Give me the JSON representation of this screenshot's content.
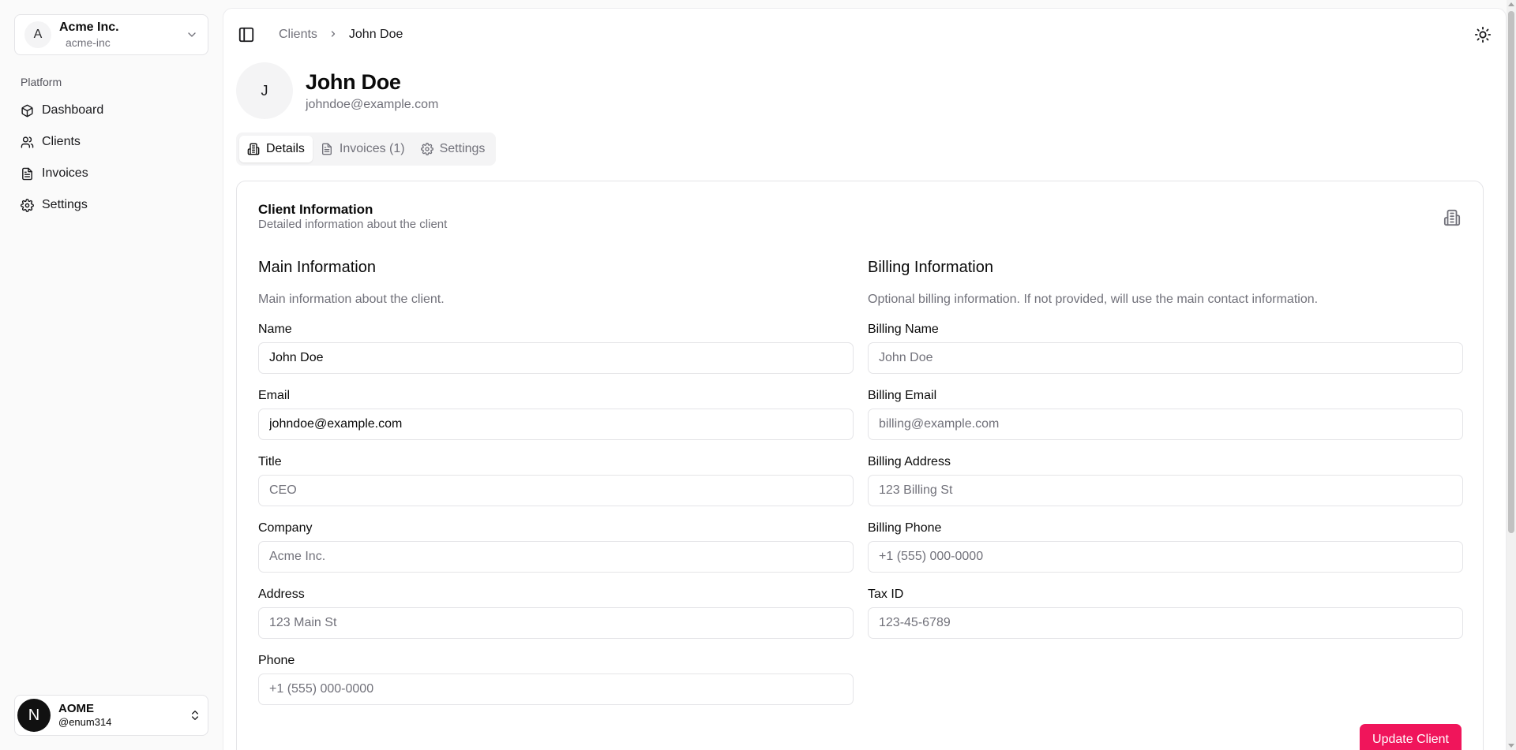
{
  "team": {
    "initial": "A",
    "name": "Acme Inc.",
    "slug": "acme-inc"
  },
  "sidebar": {
    "group_label": "Platform",
    "items": [
      {
        "label": "Dashboard",
        "icon": "box-icon"
      },
      {
        "label": "Clients",
        "icon": "users-icon"
      },
      {
        "label": "Invoices",
        "icon": "file-text-icon"
      },
      {
        "label": "Settings",
        "icon": "gear-icon"
      }
    ]
  },
  "user": {
    "initial": "N",
    "name": "AOME",
    "handle": "@enum314"
  },
  "breadcrumb": {
    "parent": "Clients",
    "current": "John Doe"
  },
  "profile": {
    "initial": "J",
    "name": "John Doe",
    "email": "johndoe@example.com"
  },
  "tabs": [
    {
      "label": "Details",
      "active": true
    },
    {
      "label": "Invoices (1)",
      "active": false
    },
    {
      "label": "Settings",
      "active": false
    }
  ],
  "card": {
    "title": "Client Information",
    "description": "Detailed information about the client"
  },
  "main_info": {
    "title": "Main Information",
    "description": "Main information about the client.",
    "fields": [
      {
        "label": "Name",
        "value": "John Doe",
        "placeholder": ""
      },
      {
        "label": "Email",
        "value": "johndoe@example.com",
        "placeholder": ""
      },
      {
        "label": "Title",
        "value": "",
        "placeholder": "CEO"
      },
      {
        "label": "Company",
        "value": "",
        "placeholder": "Acme Inc."
      },
      {
        "label": "Address",
        "value": "",
        "placeholder": "123 Main St"
      },
      {
        "label": "Phone",
        "value": "",
        "placeholder": "+1 (555) 000-0000"
      }
    ]
  },
  "billing_info": {
    "title": "Billing Information",
    "description": "Optional billing information. If not provided, will use the main contact information.",
    "fields": [
      {
        "label": "Billing Name",
        "value": "",
        "placeholder": "John Doe"
      },
      {
        "label": "Billing Email",
        "value": "",
        "placeholder": "billing@example.com"
      },
      {
        "label": "Billing Address",
        "value": "",
        "placeholder": "123 Billing St"
      },
      {
        "label": "Billing Phone",
        "value": "",
        "placeholder": "+1 (555) 000-0000"
      },
      {
        "label": "Tax ID",
        "value": "",
        "placeholder": "123-45-6789"
      }
    ]
  },
  "actions": {
    "update_label": "Update Client"
  },
  "colors": {
    "accent": "#f0155b",
    "muted_text": "#71717a",
    "border": "#e4e4e7"
  }
}
